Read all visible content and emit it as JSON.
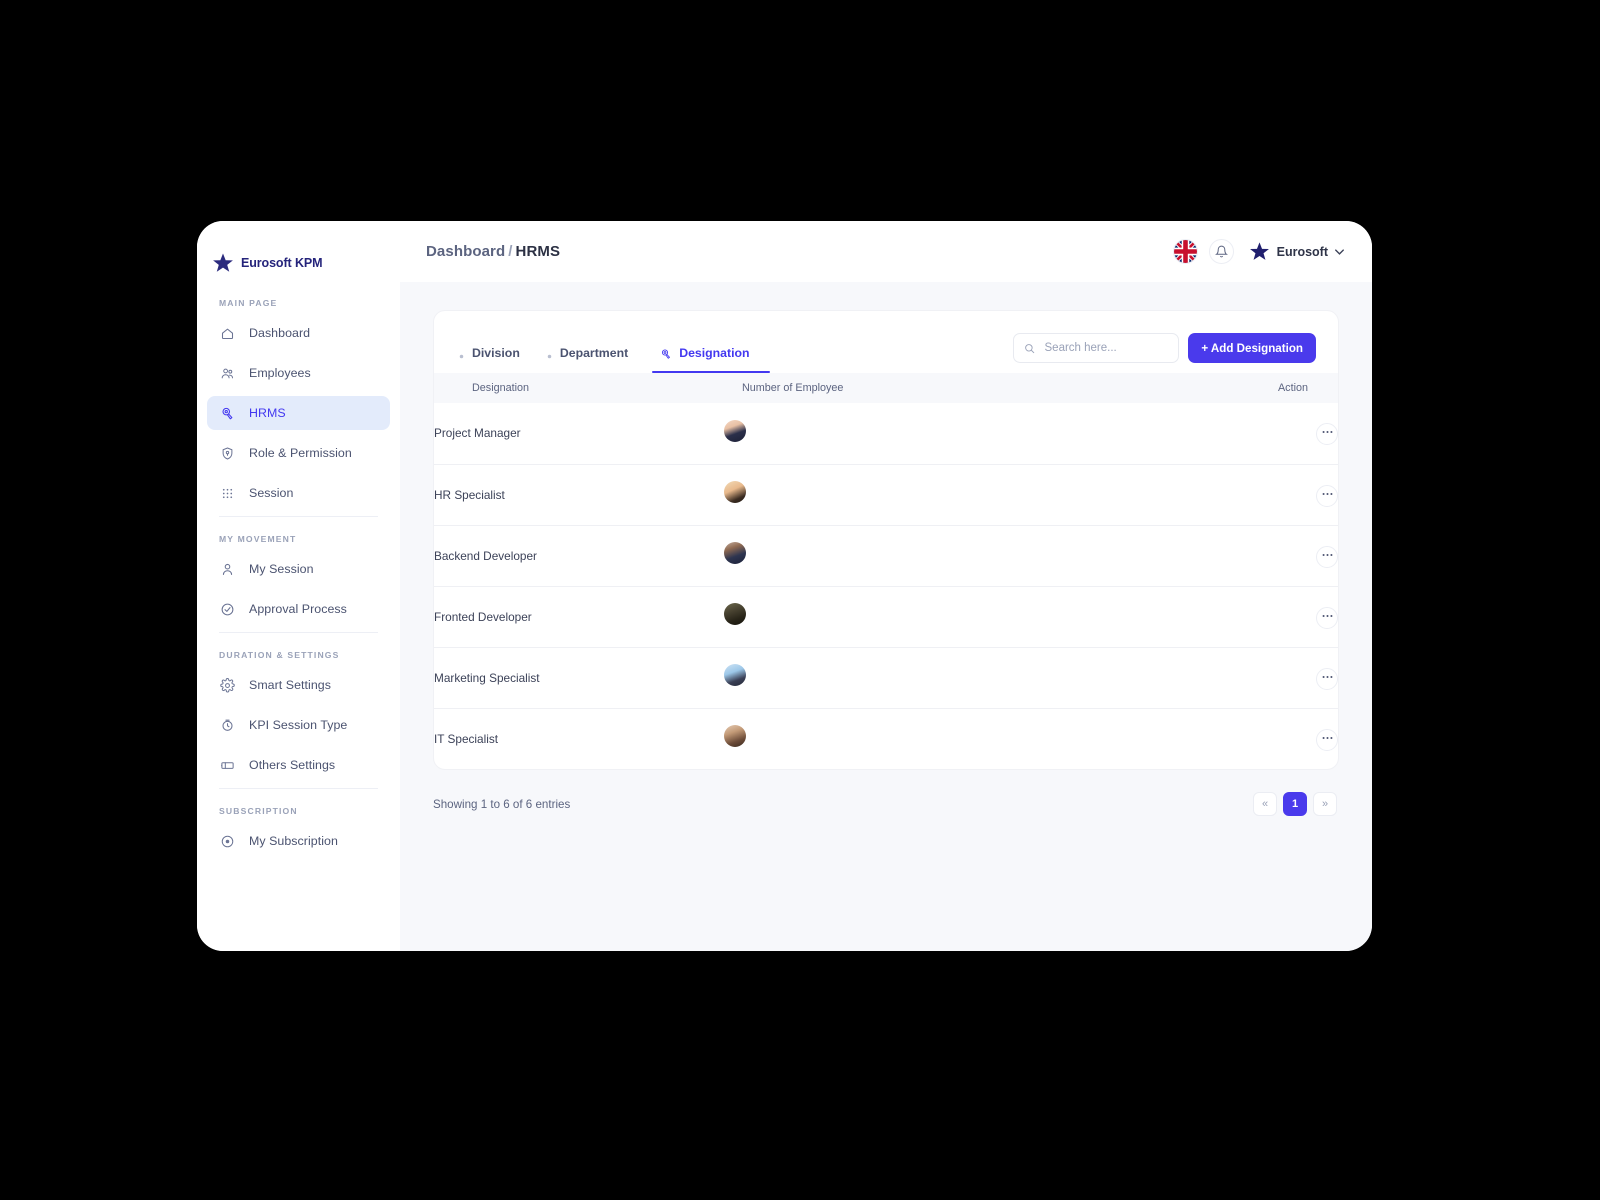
{
  "brand": {
    "name": "Eurosoft KPM",
    "icon": "star-icon"
  },
  "sidebar": {
    "groups": [
      {
        "label": "MAIN PAGE",
        "items": [
          {
            "label": "Dashboard",
            "icon": "home-icon",
            "active": false
          },
          {
            "label": "Employees",
            "icon": "users-icon",
            "active": false
          },
          {
            "label": "HRMS",
            "icon": "badge-icon",
            "active": true
          },
          {
            "label": "Role & Permission",
            "icon": "shield-icon",
            "active": false
          },
          {
            "label": "Session",
            "icon": "grid-icon",
            "active": false
          }
        ]
      },
      {
        "label": "MY MOVEMENT",
        "items": [
          {
            "label": "My Session",
            "icon": "person-icon",
            "active": false
          },
          {
            "label": "Approval Process",
            "icon": "check-circle-icon",
            "active": false
          }
        ]
      },
      {
        "label": "DURATION & SETTINGS",
        "items": [
          {
            "label": "Smart Settings",
            "icon": "gear-icon",
            "active": false
          },
          {
            "label": "KPI Session Type",
            "icon": "clock-icon",
            "active": false
          },
          {
            "label": "Others Settings",
            "icon": "ticket-icon",
            "active": false
          }
        ]
      },
      {
        "label": "SUBSCRIPTION",
        "items": [
          {
            "label": "My Subscription",
            "icon": "coin-icon",
            "active": false
          }
        ]
      }
    ]
  },
  "topbar": {
    "breadcrumb": {
      "parent": "Dashboard",
      "separator": "/",
      "current": "HRMS"
    },
    "language_icon": "uk-flag-icon",
    "notification_icon": "bell-icon",
    "user": {
      "name": "Eurosoft",
      "avatar_icon": "star-avatar-icon",
      "chevron": "chevron-down-icon"
    }
  },
  "card": {
    "tabs": [
      {
        "label": "Division",
        "icon": "dot-icon",
        "active": false
      },
      {
        "label": "Department",
        "icon": "dot-icon",
        "active": false
      },
      {
        "label": "Designation",
        "icon": "badge-icon",
        "active": true
      }
    ],
    "search": {
      "placeholder": "Search here...",
      "value": "",
      "icon": "search-icon"
    },
    "add_button": {
      "label": "+ Add Designation",
      "color": "#4a3aec"
    },
    "table": {
      "columns": [
        "Designation",
        "Number of Employee",
        "Action"
      ],
      "rows": [
        {
          "designation": "Project Manager",
          "avatar": "avatar-1",
          "action_icon": "more-dots-icon"
        },
        {
          "designation": "HR Specialist",
          "avatar": "avatar-2",
          "action_icon": "more-dots-icon"
        },
        {
          "designation": "Backend Developer",
          "avatar": "avatar-3",
          "action_icon": "more-dots-icon"
        },
        {
          "designation": "Fronted Developer",
          "avatar": "avatar-4",
          "action_icon": "more-dots-icon"
        },
        {
          "designation": "Marketing Specialist",
          "avatar": "avatar-5",
          "action_icon": "more-dots-icon"
        },
        {
          "designation": "IT Specialist",
          "avatar": "avatar-6",
          "action_icon": "more-dots-icon"
        }
      ]
    }
  },
  "footer": {
    "showing": "Showing 1 to 6 of 6 entries",
    "pagination": [
      {
        "label": "«",
        "active": false,
        "name": "prev"
      },
      {
        "label": "1",
        "active": true,
        "name": "page-1"
      },
      {
        "label": "»",
        "active": false,
        "name": "next"
      }
    ]
  }
}
